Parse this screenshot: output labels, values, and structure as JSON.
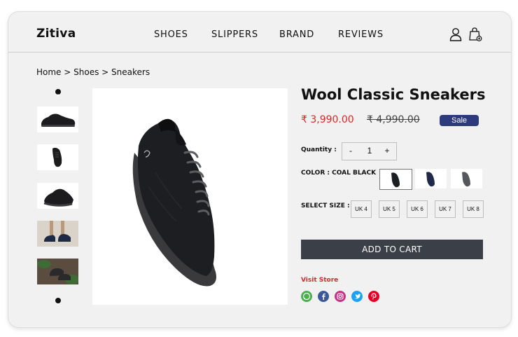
{
  "header": {
    "logo": "Zitiva",
    "nav": [
      "SHOES",
      "SLIPPERS",
      "BRAND",
      "REVIEWS"
    ],
    "icons": [
      "user-icon",
      "shopping-bag-icon"
    ]
  },
  "breadcrumb": {
    "items": [
      "Home",
      "Shoes",
      "Sneakers"
    ],
    "separator": ">"
  },
  "gallery": {
    "thumbnails": [
      "shoe-side-view",
      "shoe-top-view",
      "shoe-angled-view",
      "shoe-worn-on-feet",
      "shoe-lifestyle-photo"
    ],
    "up_icon": "arrow-up-icon",
    "down_icon": "arrow-down-icon"
  },
  "product": {
    "title": "Wool Classic Sneakers",
    "price": "₹ 3,990.00",
    "original_price": "₹ 4,990.00",
    "badge": "Sale",
    "quantity_label": "Quantity :",
    "quantity": {
      "minus": "-",
      "value": "1",
      "plus": "+"
    },
    "color_label": "COLOR : COAL BLACK",
    "colors": [
      "coal black",
      "navy",
      "grey"
    ],
    "size_label": "SELECT SIZE :",
    "sizes": [
      "UK 4",
      "UK 5",
      "UK 6",
      "UK 7",
      "UK 8"
    ],
    "add_to_cart": "ADD TO CART",
    "visit_store": "Visit Store",
    "social": [
      "whatsapp-icon",
      "facebook-icon",
      "instagram-icon",
      "twitter-icon",
      "pinterest-icon"
    ]
  },
  "colors": {
    "accent_price": "#e02424",
    "sale_badge": "#2d3a7c",
    "cart_button": "#3b3f47",
    "visit_store": "#d62a2a",
    "whatsapp": "#4caf50",
    "facebook": "#3b5998",
    "instagram": "#c13584",
    "twitter": "#1da1f2",
    "pinterest": "#e60023"
  }
}
